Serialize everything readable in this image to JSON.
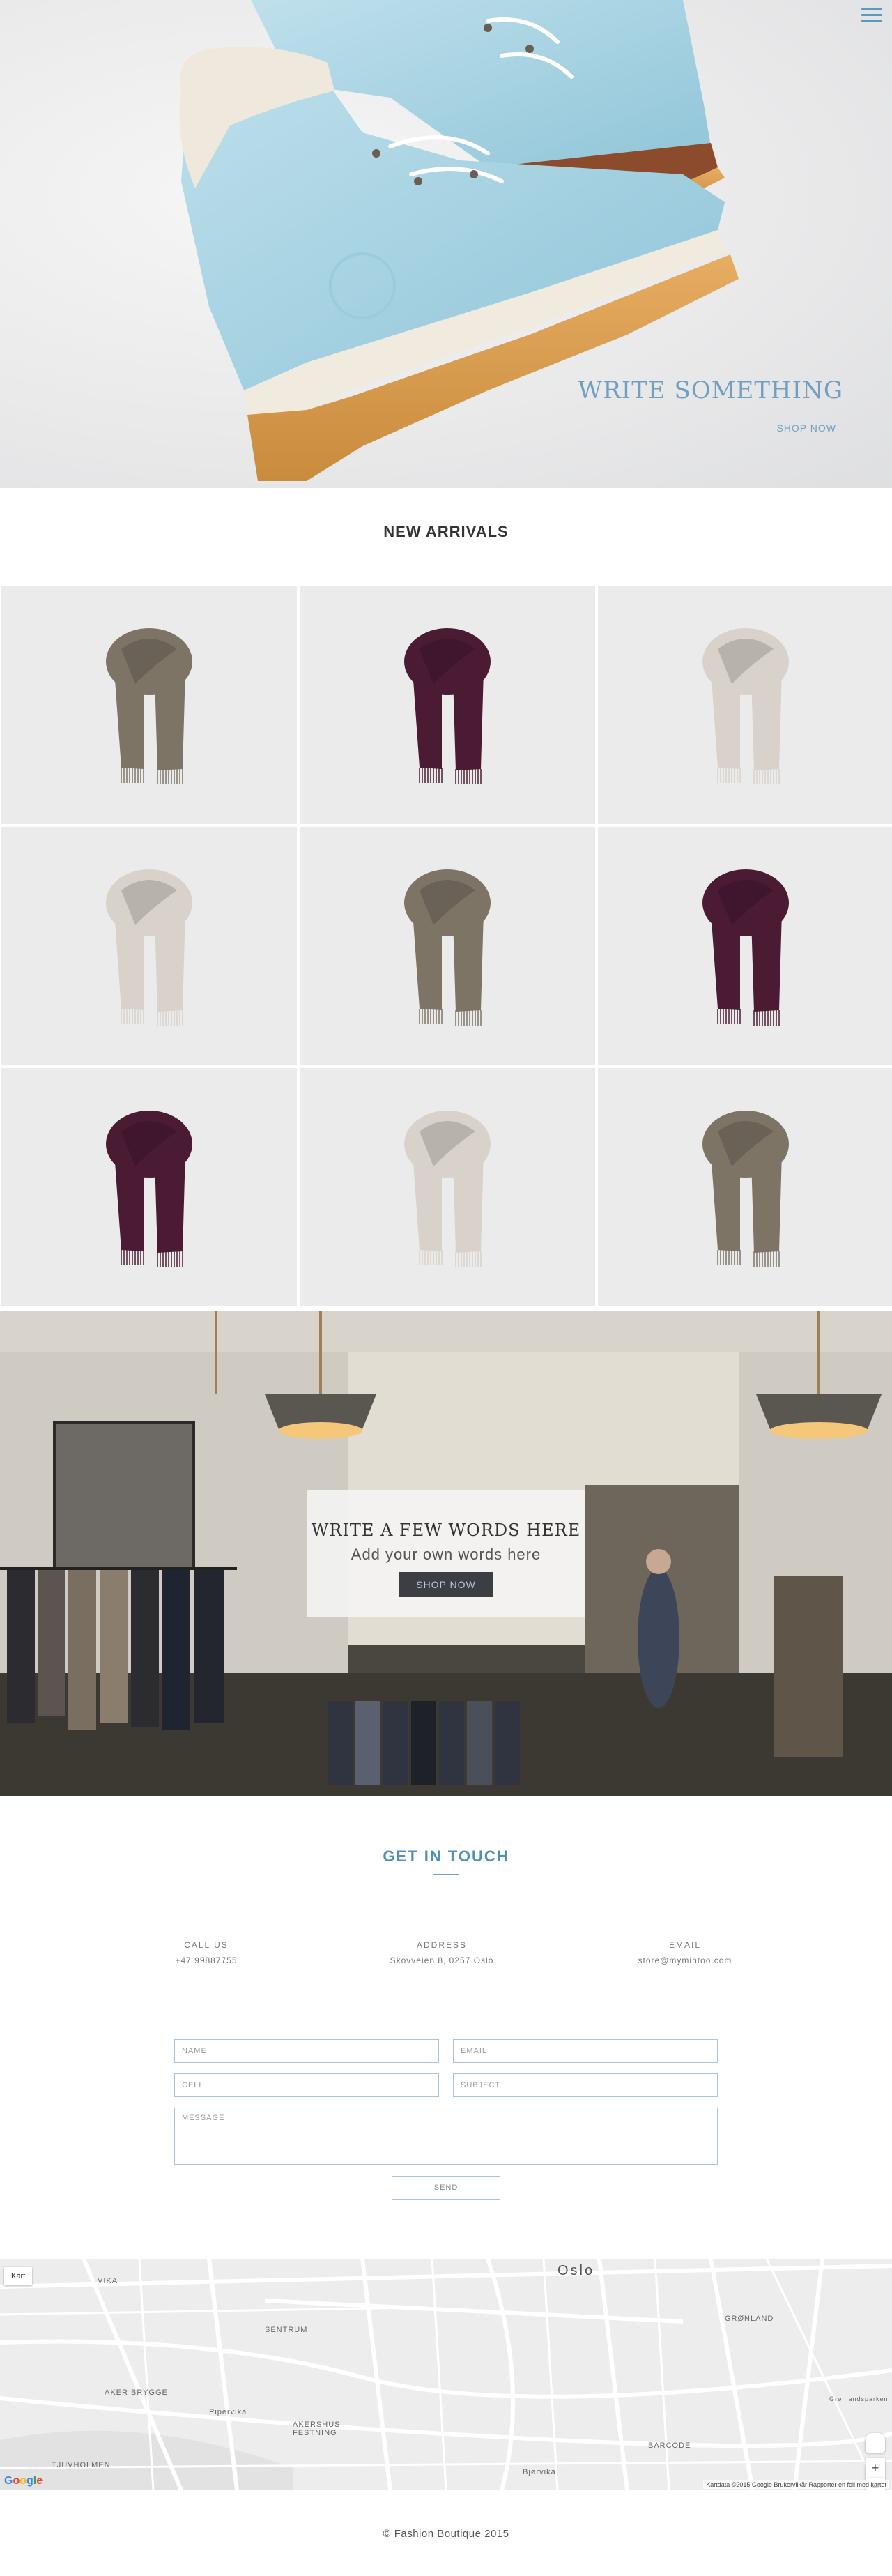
{
  "hero": {
    "title": "WRITE SOMETHING",
    "link": "SHOP NOW",
    "menu_icon": "hamburger-menu-icon",
    "accent": "#6fa0c4"
  },
  "arrivals": {
    "title": "NEW ARRIVALS",
    "products": [
      {
        "color": "taupe",
        "hex": "#7d7466"
      },
      {
        "color": "plum",
        "hex": "#4a1b33"
      },
      {
        "color": "ivory",
        "hex": "#d9d2cb"
      },
      {
        "color": "ivory",
        "hex": "#d9d2cb"
      },
      {
        "color": "taupe",
        "hex": "#7d7466"
      },
      {
        "color": "plum",
        "hex": "#4a1b33"
      },
      {
        "color": "plum",
        "hex": "#4a1b33"
      },
      {
        "color": "ivory",
        "hex": "#d9d2cb"
      },
      {
        "color": "taupe",
        "hex": "#7d7466"
      }
    ]
  },
  "banner": {
    "title": "WRITE A FEW WORDS HERE",
    "subtitle": "Add your own words here",
    "button": "SHOP NOW"
  },
  "contact": {
    "title": "GET IN TOUCH",
    "call_label": "CALL US",
    "call_value": "+47 99887755",
    "address_label": "ADDRESS",
    "address_value": "Skovveien 8, 0257 Oslo",
    "email_label": "EMAIL",
    "email_value": "store@mymintoo.com",
    "form": {
      "name": "NAME",
      "email": "EMAIL",
      "cell": "CELL",
      "subject": "SUBJECT",
      "message": "MESSAGE",
      "send": "SEND"
    }
  },
  "map": {
    "kart_button": "Kart",
    "labels": [
      "Oslo",
      "VIKA",
      "SENTRUM",
      "GRØNLAND",
      "AKER BRYGGE",
      "Pipervika",
      "AKERSHUS FESTNING",
      "TJUVHOLMEN",
      "BARCODE",
      "Bjørvika",
      "Grønlandsparken"
    ],
    "google": "Google",
    "footer": "Kartdata ©2015 Google   Brukervilkår   Rapporter en feil med kartet",
    "zoom_in": "+",
    "zoom_out": "−"
  },
  "footer": {
    "text": "© Fashion Boutique 2015"
  }
}
